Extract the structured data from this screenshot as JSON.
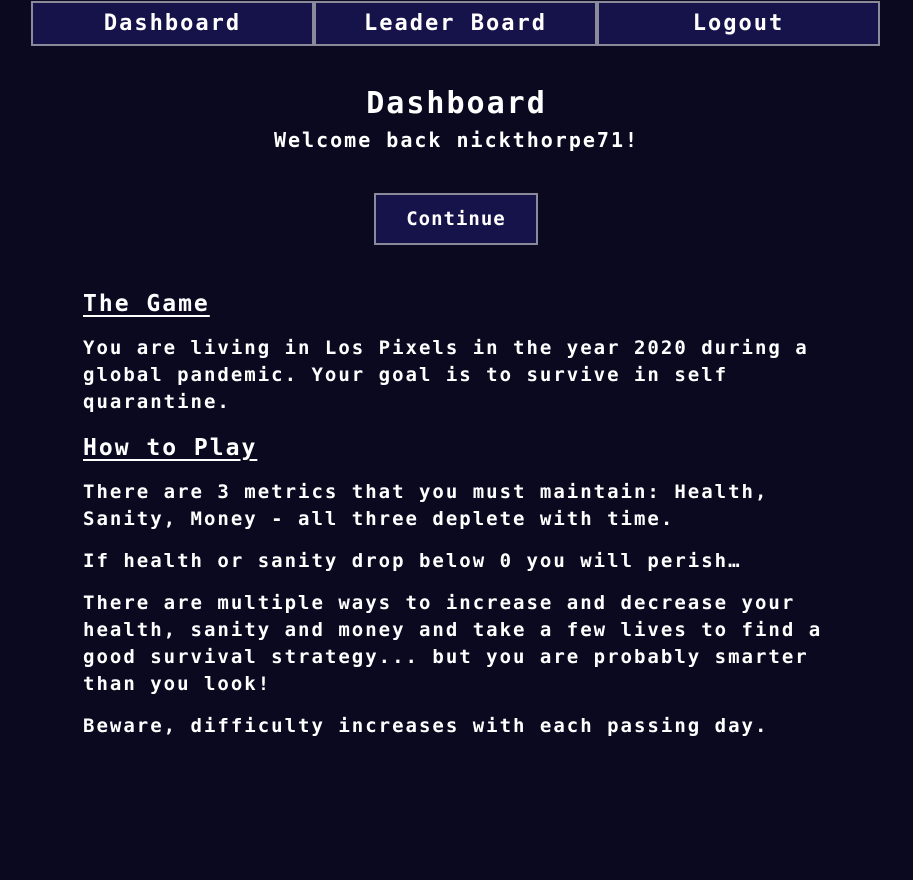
{
  "nav": {
    "dashboard": "Dashboard",
    "leaderboard": "Leader Board",
    "logout": "Logout"
  },
  "page": {
    "title": "Dashboard",
    "welcome": "Welcome back nickthorpe71!",
    "continue_label": "Continue"
  },
  "sections": {
    "game_heading": "The Game",
    "game_text": "You are living in Los Pixels in the year 2020 during a global pandemic. Your goal is to survive in self quarantine.",
    "howto_heading": "How to Play",
    "howto_p1": "There are 3 metrics that you must maintain: Health, Sanity, Money - all three deplete with time.",
    "howto_p2": "If health or sanity drop below 0 you will perish…",
    "howto_p3": "There are multiple ways to increase and decrease your health, sanity and money and take a few lives to find a good survival strategy... but you are probably smarter than you look!",
    "howto_p4": "Beware, difficulty increases with each passing day."
  },
  "colors": {
    "background": "#0b0920",
    "button_bg": "#16124a",
    "button_border": "#8a8a9a",
    "text": "#ffffff"
  }
}
